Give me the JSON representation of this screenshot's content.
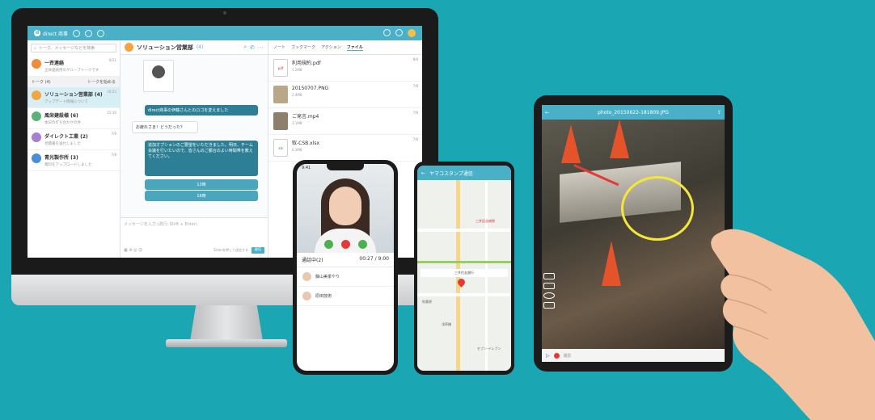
{
  "desktop": {
    "brand": "direct 商事",
    "search_placeholder": "トーク、メッセージなどを検索",
    "talk_header": "トーク (4)",
    "start_talk": "トークを始める",
    "talks": [
      {
        "name": "一斉連絡",
        "sub": "全体連絡用のグループトークです",
        "time": "8/21",
        "color": "#ef8c3a"
      },
      {
        "name": "ソリューション営業部 (4)",
        "sub": "アップデート情報について",
        "time": "16:25",
        "color": "#f2a541"
      },
      {
        "name": "風栄建設様 (6)",
        "sub": "本日の打ち合わせの件",
        "time": "15:30",
        "color": "#5bb37a"
      },
      {
        "name": "ダイレクト工業 (2)",
        "sub": "見積書を送付しました",
        "time": "7/9",
        "color": "#a77fd1"
      },
      {
        "name": "青光製作所 (3)",
        "sub": "資料をアップロードしました",
        "time": "7/8",
        "color": "#4a8fd6"
      }
    ],
    "chat": {
      "title": "ソリューション営業部",
      "count": "(4)",
      "msg1": "direct商事の伊藤さんとのロゴを変えました",
      "msg2": "お疲れさま！どうだった？",
      "msg3": "追加オプションのご要望をいただきました。明日、チーム会議を行いたいので、皆さんのご都合のよい時間帯を教えてください。",
      "opt1": "13時",
      "opt2": "16時",
      "input_placeholder": "メッセージを入力 (改行: Shift + Enter)",
      "send_label": "送信",
      "enter_hint": "Enterを押して送信する"
    },
    "file_tabs": [
      "ノート",
      "ブックマーク",
      "アクション",
      "ファイル"
    ],
    "files": [
      {
        "name": "利用規約.pdf",
        "meta": "1.2MB",
        "date": "8/8",
        "type": "pdf"
      },
      {
        "name": "20150707.PNG",
        "meta": "2.4MB",
        "date": "7/8",
        "type": "img"
      },
      {
        "name": "ご発言.mp4",
        "meta": "3.1MB",
        "date": "7/8",
        "type": "mp4"
      },
      {
        "name": "取-CSB.xlsx",
        "meta": "0.3MB",
        "date": "7/8",
        "type": "xls"
      }
    ]
  },
  "call_phone": {
    "time": "9:41",
    "status": "通話中(2)",
    "duration": "00:27 / 9:00",
    "members": [
      "藤山美季やり",
      "原田技術"
    ]
  },
  "map_phone": {
    "title": "ヤマコスタンプ通信",
    "popup": "三井住友銀行",
    "labels": [
      "三井記念病院",
      "秋葉原",
      "浅草橋",
      "セブン-イレブン"
    ]
  },
  "ipad": {
    "title": "photo_20150622-181809.JPG",
    "bottom_label": "撮影"
  }
}
